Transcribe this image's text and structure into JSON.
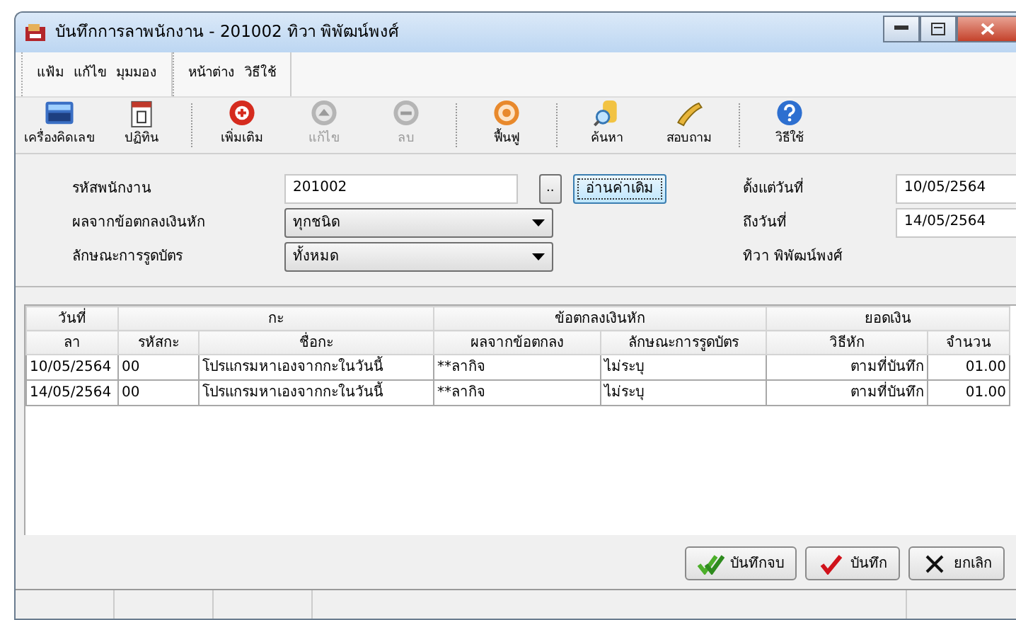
{
  "window": {
    "title": "บันทึกการลาพนักงาน - 201002  ทิวา พิพัฒน์พงศ์"
  },
  "menu": [
    {
      "label": "แฟ้ม"
    },
    {
      "label": "แก้ไข"
    },
    {
      "label": "มุมมอง"
    },
    {
      "label": "หน้าต่าง"
    },
    {
      "label": "วิธีใช้"
    }
  ],
  "toolbar": [
    {
      "items": [
        {
          "label": "เครื่องคิดเลข",
          "kind": "calculator",
          "disabled": false
        },
        {
          "label": "ปฏิทิน",
          "kind": "calendar",
          "disabled": false
        }
      ]
    },
    {
      "items": [
        {
          "label": "เพิ่มเติม",
          "kind": "add",
          "disabled": false
        },
        {
          "label": "แก้ไข",
          "kind": "up",
          "disabled": true
        },
        {
          "label": "ลบ",
          "kind": "remove",
          "disabled": true
        }
      ]
    },
    {
      "items": [
        {
          "label": "ฟื้นฟู",
          "kind": "refresh",
          "disabled": false
        }
      ]
    },
    {
      "items": [
        {
          "label": "ค้นหา",
          "kind": "search",
          "disabled": false
        },
        {
          "label": "สอบถาม",
          "kind": "phone",
          "disabled": false
        }
      ]
    },
    {
      "items": [
        {
          "label": "วิธีใช้",
          "kind": "help",
          "disabled": false
        }
      ]
    }
  ],
  "form": {
    "employee_code_label": "รหัสพนักงาน",
    "employee_code": "201002",
    "browse_button": "..",
    "reload_button": "อ่านค่าเดิม",
    "deduction_label": "ผลจากข้อตกลงเงินหัก",
    "deduction": "ทุกชนิด",
    "card_label": "ลักษณะการรูดบัตร",
    "card": "ทั้งหมด",
    "from_label": "ตั้งแต่วันที่",
    "from": "10/05/2564",
    "to_label": "ถึงวันที่",
    "to": "14/05/2564",
    "employee_name": "ทิวา พิพัฒน์พงศ์"
  },
  "table": {
    "groups": [
      "วันที่",
      "กะ",
      "ข้อตกลงเงินหัก",
      "ยอดเงิน"
    ],
    "columns": [
      "ลา",
      "รหัสกะ",
      "ชื่อกะ",
      "ผลจากข้อตกลง",
      "ลักษณะการรูดบัตร",
      "วิธีหัก",
      "จำนวน"
    ],
    "rows": [
      [
        "10/05/2564",
        "00",
        "โปรแกรมหาเองจากกะในวันนี้",
        "**ลากิจ",
        "ไม่ระบุ",
        "ตามที่บันทึก",
        "01.00"
      ],
      [
        "14/05/2564",
        "00",
        "โปรแกรมหาเองจากกะในวันนี้",
        "**ลากิจ",
        "ไม่ระบุ",
        "ตามที่บันทึก",
        "01.00"
      ]
    ]
  },
  "buttons": [
    {
      "label": "บันทึกจบ",
      "kind": "save_close"
    },
    {
      "label": "บันทึก",
      "kind": "save"
    },
    {
      "label": "ยกเลิก",
      "kind": "cancel"
    }
  ]
}
